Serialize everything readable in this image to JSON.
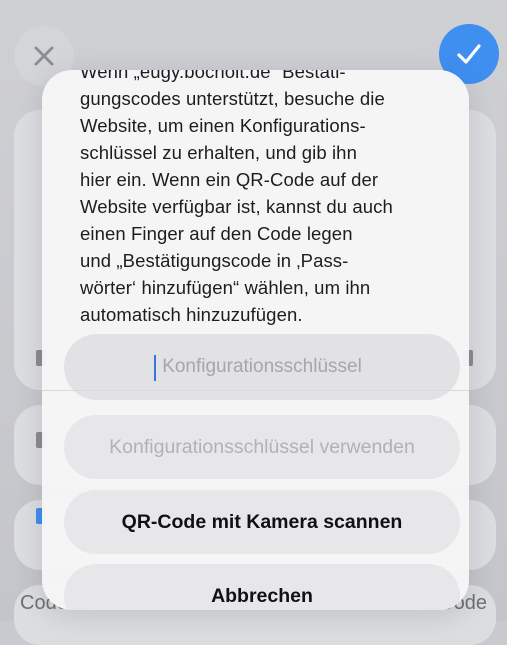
{
  "background": {
    "close_icon": "close-x-icon",
    "done_icon": "checkmark-icon",
    "left_label": "Code",
    "right_label": "Kein Code"
  },
  "alert": {
    "message": "Wenn „eugy.bocholt.de“ Bestäti-\ngungscodes unterstützt, besuche die\nWebsite, um einen Konfigurations-\nschlüssel zu erhalten, und gib ihn\nhier ein. Wenn ein QR-Code auf der\nWebsite verfügbar ist, kannst du auch\neinen Finger auf den Code legen\nund „Bestätigungscode in ‚Pass-\nwörter‘ hinzufügen“ wählen, um ihn\nautomatisch hinzuzufügen.",
    "input_placeholder": "Konfigurationsschlüssel",
    "input_value": "",
    "use_key_label": "Konfigurationsschlüssel verwenden",
    "scan_qr_label": "QR-Code mit Kamera scannen",
    "cancel_label": "Abbrechen"
  },
  "colors": {
    "accent": "#3f8ff0",
    "sheet_bg": "#f6f6f7",
    "disabled_text": "#b2b2b6"
  }
}
